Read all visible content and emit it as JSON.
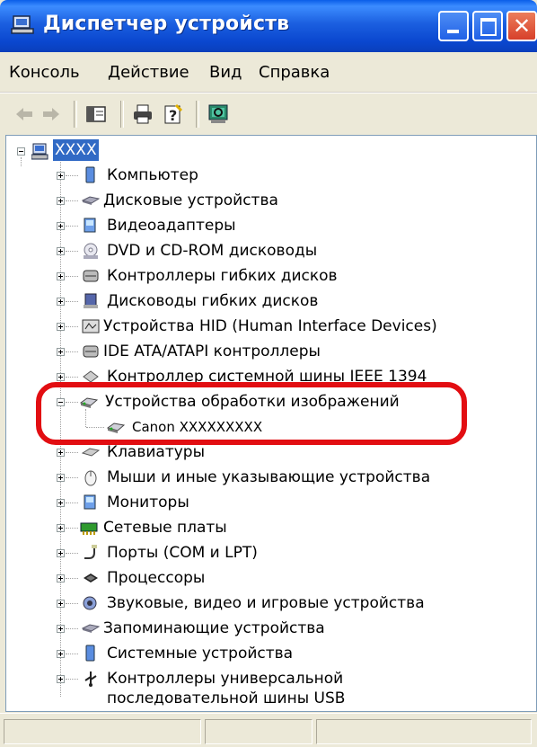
{
  "window": {
    "title": "Диспетчер устройств",
    "icon": "device-manager-icon",
    "controls": [
      "minimize-icon",
      "maximize-icon",
      "close-icon"
    ]
  },
  "menu": [
    "Консоль",
    "Действие",
    "Вид",
    "Справка"
  ],
  "toolbar": [
    "back-icon",
    "forward-icon",
    "properties-icon",
    "print-icon",
    "help-icon",
    "scan-hardware-icon"
  ],
  "tree": {
    "root": "XXXX",
    "categories": [
      "Компьютер",
      "Дисковые устройства",
      "Видеоадаптеры",
      "DVD и CD-ROM дисководы",
      "Контроллеры гибких дисков",
      "Дисководы гибких дисков",
      "Устройства HID (Human Interface Devices)",
      "IDE ATA/ATAPI контроллеры",
      "Контроллер системной шины IEEE 1394",
      "Устройства обработки изображений",
      "Canon XXXXXXXXX",
      "Клавиатуры",
      "Мыши и иные указывающие устройства",
      "Мониторы",
      "Сетевые платы",
      "Порты (COM и LPT)",
      "Процессоры",
      "Звуковые, видео и игровые устройства",
      "Запоминающие устройства",
      "Системные устройства",
      "Контроллеры универсальной",
      "последовательной шины USB"
    ]
  },
  "colors": {
    "title_bar": "#0a47cf",
    "selection": "#316ac5",
    "highlight_ring": "#e20e12"
  }
}
